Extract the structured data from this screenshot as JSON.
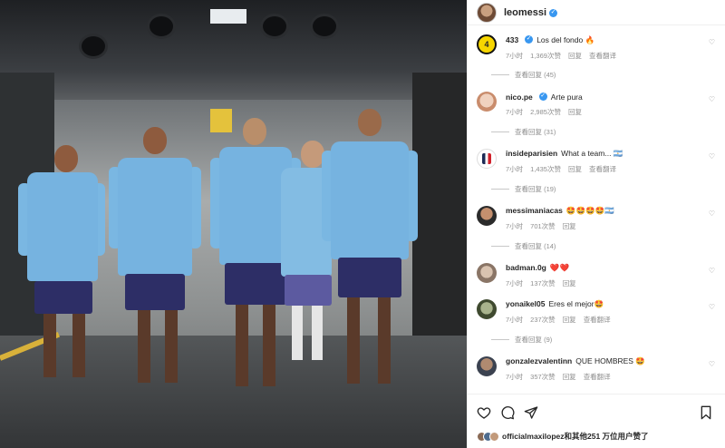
{
  "post": {
    "author": "leomessi",
    "photo_alt": "Argentina players walking through a tunnel"
  },
  "comments": [
    {
      "user": "433",
      "text": "Los del fondo 🔥",
      "time": "7小时",
      "likes": "1,369次赞",
      "reply": "回复",
      "translate": "查看翻译",
      "replies": "查看回复 (45)",
      "avatar_color": "#f7d600",
      "avatar_text": "4"
    },
    {
      "user": "nico.pe",
      "text": "Arte pura",
      "time": "7小时",
      "likes": "2,985次赞",
      "reply": "回复",
      "translate": "",
      "replies": "查看回复 (31)",
      "avatar_color": "#e9c7b3",
      "avatar_text": ""
    },
    {
      "user": "insideparisien",
      "text": "What a team... 🇦🇷",
      "time": "7小时",
      "likes": "1,435次赞",
      "reply": "回复",
      "translate": "查看翻译",
      "replies": "查看回复 (19)",
      "avatar_color": "#1d2a55",
      "avatar_text": ""
    },
    {
      "user": "messimaniacas",
      "text": "🤩🤩🤩🤩🇦🇷",
      "time": "7小时",
      "likes": "701次赞",
      "reply": "回复",
      "translate": "",
      "replies": "查看回复 (14)",
      "avatar_color": "#6a4d3f",
      "avatar_text": ""
    },
    {
      "user": "badman.0g",
      "text": "❤️❤️",
      "time": "7小时",
      "likes": "137次赞",
      "reply": "回复",
      "translate": "",
      "replies": "",
      "avatar_color": "#b7a390",
      "avatar_text": ""
    },
    {
      "user": "yonaikel05",
      "text": "Eres el mejor🤩",
      "time": "7小时",
      "likes": "237次赞",
      "reply": "回复",
      "translate": "查看翻译",
      "replies": "查看回复 (9)",
      "avatar_color": "#4e5a3d",
      "avatar_text": ""
    },
    {
      "user": "gonzalezvalentinn",
      "text": "QUE HOMBRES 🤩",
      "time": "7小时",
      "likes": "357次赞",
      "reply": "回复",
      "translate": "查看翻译",
      "replies": "",
      "avatar_color": "#3b4250",
      "avatar_text": ""
    }
  ],
  "footer": {
    "liked_by": "officialmaxilopez和其他251 万位用户赞了"
  },
  "colors": {
    "verified": "#3897f0",
    "muted": "#8e8e8e"
  }
}
